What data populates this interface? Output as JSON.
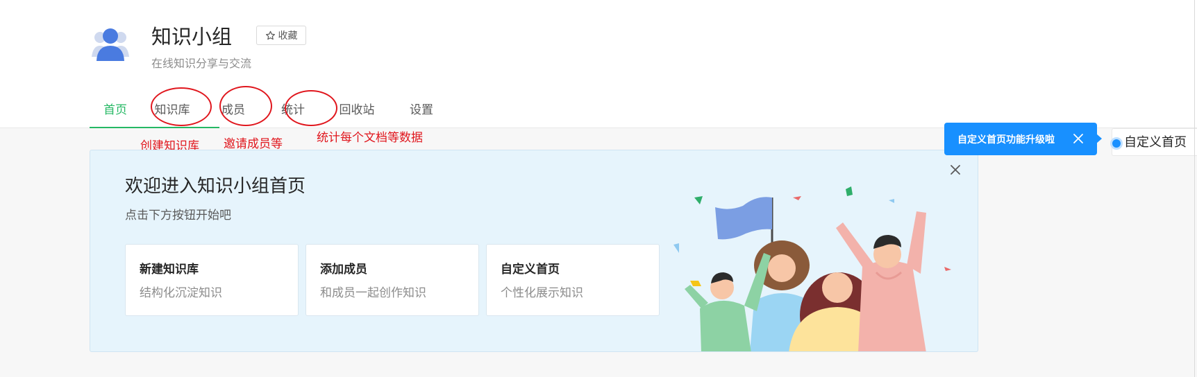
{
  "group": {
    "title": "知识小组",
    "subtitle": "在线知识分享与交流",
    "favorite_label": "收藏"
  },
  "tabs": [
    {
      "label": "首页",
      "active": true
    },
    {
      "label": "知识库",
      "active": false
    },
    {
      "label": "成员",
      "active": false
    },
    {
      "label": "统计",
      "active": false
    },
    {
      "label": "回收站",
      "active": false
    },
    {
      "label": "设置",
      "active": false
    }
  ],
  "annotations": {
    "knowledge_base": "创建知识库",
    "members": "邀请成员等",
    "stats": "统计每个文档等数据"
  },
  "welcome": {
    "title": "欢迎进入知识小组首页",
    "subtitle": "点击下方按钮开始吧",
    "actions": [
      {
        "title": "新建知识库",
        "desc": "结构化沉淀知识"
      },
      {
        "title": "添加成员",
        "desc": "和成员一起创作知识"
      },
      {
        "title": "自定义首页",
        "desc": "个性化展示知识"
      }
    ]
  },
  "tooltip": {
    "text": "自定义首页功能升级啦"
  },
  "custom_home_button": {
    "label": "自定义首页"
  },
  "colors": {
    "accent_green": "#25b864",
    "annotation_red": "#e0161d",
    "tooltip_blue": "#1890ff",
    "welcome_bg": "#e6f4fc"
  },
  "icons": [
    "group-avatar-icon",
    "star-icon",
    "close-icon",
    "tooltip-close-icon"
  ]
}
